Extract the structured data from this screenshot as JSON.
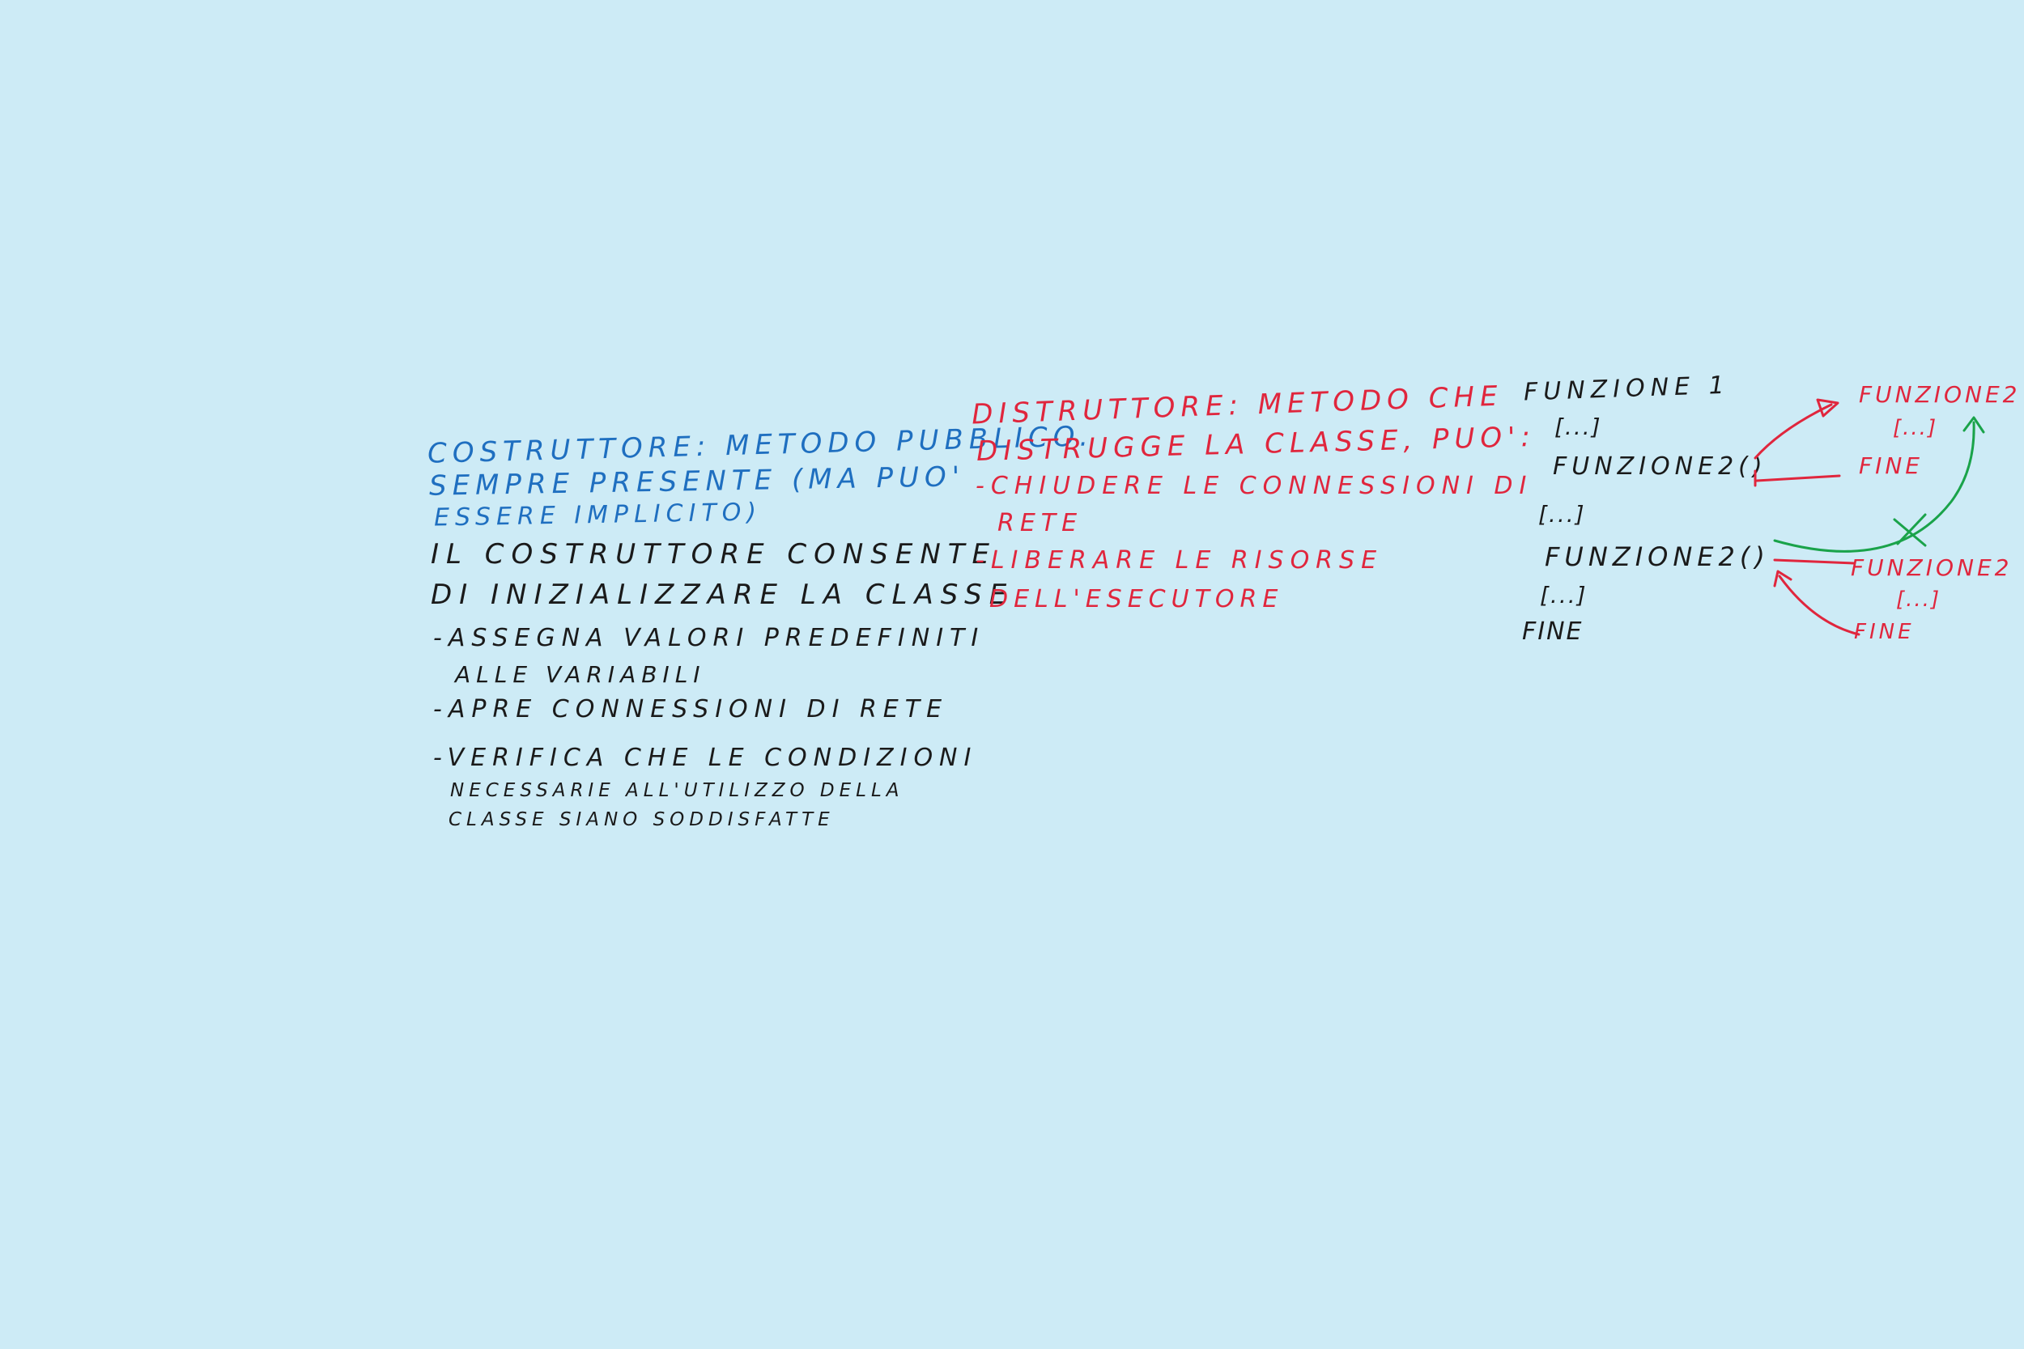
{
  "colors": {
    "background": "#cdebf6",
    "blue_ink": "#1f6fc0",
    "black_ink": "#1a1a1a",
    "red_ink": "#e0263d",
    "green_ink": "#1aa34a"
  },
  "costruttore": {
    "heading_lines": [
      "COSTRUTTORE: METODO PUBBLICO.",
      "SEMPRE PRESENTE (MA PUO'",
      "ESSERE IMPLICITO)"
    ],
    "intro_lines": [
      "IL COSTRUTTORE CONSENTE",
      "DI INIZIALIZZARE LA CLASSE"
    ],
    "bullets": [
      "-ASSEGNA VALORI PREDEFINITI",
      "ALLE VARIABILI",
      "-APRE CONNESSIONI DI RETE",
      "-VERIFICA CHE LE CONDIZIONI",
      "NECESSARIE ALL'UTILIZZO DELLA",
      "CLASSE SIANO SODDISFATTE"
    ]
  },
  "distruttore": {
    "lines": [
      "DISTRUTTORE: METODO CHE",
      "DISTRUGGE LA CLASSE, PUO':",
      "-CHIUDERE LE CONNESSIONI DI",
      "RETE",
      "-LIBERARE LE RISORSE",
      "DELL'ESECUTORE"
    ]
  },
  "diagram": {
    "main": [
      "FUNZIONE 1",
      "[...]",
      "FUNZIONE2()",
      "[...]",
      "FUNZIONE2()",
      "[...]",
      "FINE"
    ],
    "sub_top": [
      "FUNZIONE2",
      "[...]",
      "FINE"
    ],
    "sub_bottom": [
      "FUNZIONE2",
      "[...]",
      "FINE"
    ]
  }
}
